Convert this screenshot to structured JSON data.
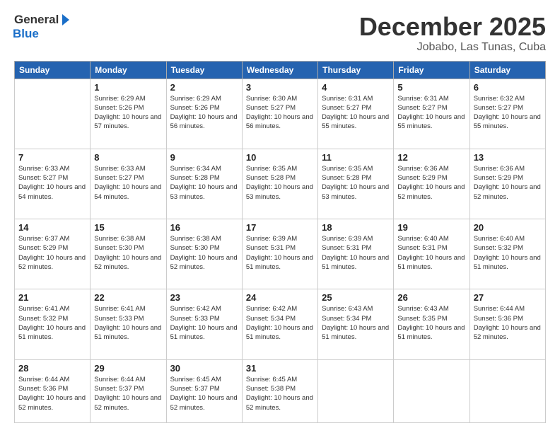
{
  "header": {
    "logo_general": "General",
    "logo_blue": "Blue",
    "month": "December 2025",
    "location": "Jobabo, Las Tunas, Cuba"
  },
  "days_of_week": [
    "Sunday",
    "Monday",
    "Tuesday",
    "Wednesday",
    "Thursday",
    "Friday",
    "Saturday"
  ],
  "weeks": [
    [
      {
        "day": "",
        "info": ""
      },
      {
        "day": "1",
        "info": "Sunrise: 6:29 AM\nSunset: 5:26 PM\nDaylight: 10 hours\nand 57 minutes."
      },
      {
        "day": "2",
        "info": "Sunrise: 6:29 AM\nSunset: 5:26 PM\nDaylight: 10 hours\nand 56 minutes."
      },
      {
        "day": "3",
        "info": "Sunrise: 6:30 AM\nSunset: 5:27 PM\nDaylight: 10 hours\nand 56 minutes."
      },
      {
        "day": "4",
        "info": "Sunrise: 6:31 AM\nSunset: 5:27 PM\nDaylight: 10 hours\nand 55 minutes."
      },
      {
        "day": "5",
        "info": "Sunrise: 6:31 AM\nSunset: 5:27 PM\nDaylight: 10 hours\nand 55 minutes."
      },
      {
        "day": "6",
        "info": "Sunrise: 6:32 AM\nSunset: 5:27 PM\nDaylight: 10 hours\nand 55 minutes."
      }
    ],
    [
      {
        "day": "7",
        "info": "Sunrise: 6:33 AM\nSunset: 5:27 PM\nDaylight: 10 hours\nand 54 minutes."
      },
      {
        "day": "8",
        "info": "Sunrise: 6:33 AM\nSunset: 5:27 PM\nDaylight: 10 hours\nand 54 minutes."
      },
      {
        "day": "9",
        "info": "Sunrise: 6:34 AM\nSunset: 5:28 PM\nDaylight: 10 hours\nand 53 minutes."
      },
      {
        "day": "10",
        "info": "Sunrise: 6:35 AM\nSunset: 5:28 PM\nDaylight: 10 hours\nand 53 minutes."
      },
      {
        "day": "11",
        "info": "Sunrise: 6:35 AM\nSunset: 5:28 PM\nDaylight: 10 hours\nand 53 minutes."
      },
      {
        "day": "12",
        "info": "Sunrise: 6:36 AM\nSunset: 5:29 PM\nDaylight: 10 hours\nand 52 minutes."
      },
      {
        "day": "13",
        "info": "Sunrise: 6:36 AM\nSunset: 5:29 PM\nDaylight: 10 hours\nand 52 minutes."
      }
    ],
    [
      {
        "day": "14",
        "info": "Sunrise: 6:37 AM\nSunset: 5:29 PM\nDaylight: 10 hours\nand 52 minutes."
      },
      {
        "day": "15",
        "info": "Sunrise: 6:38 AM\nSunset: 5:30 PM\nDaylight: 10 hours\nand 52 minutes."
      },
      {
        "day": "16",
        "info": "Sunrise: 6:38 AM\nSunset: 5:30 PM\nDaylight: 10 hours\nand 52 minutes."
      },
      {
        "day": "17",
        "info": "Sunrise: 6:39 AM\nSunset: 5:31 PM\nDaylight: 10 hours\nand 51 minutes."
      },
      {
        "day": "18",
        "info": "Sunrise: 6:39 AM\nSunset: 5:31 PM\nDaylight: 10 hours\nand 51 minutes."
      },
      {
        "day": "19",
        "info": "Sunrise: 6:40 AM\nSunset: 5:31 PM\nDaylight: 10 hours\nand 51 minutes."
      },
      {
        "day": "20",
        "info": "Sunrise: 6:40 AM\nSunset: 5:32 PM\nDaylight: 10 hours\nand 51 minutes."
      }
    ],
    [
      {
        "day": "21",
        "info": "Sunrise: 6:41 AM\nSunset: 5:32 PM\nDaylight: 10 hours\nand 51 minutes."
      },
      {
        "day": "22",
        "info": "Sunrise: 6:41 AM\nSunset: 5:33 PM\nDaylight: 10 hours\nand 51 minutes."
      },
      {
        "day": "23",
        "info": "Sunrise: 6:42 AM\nSunset: 5:33 PM\nDaylight: 10 hours\nand 51 minutes."
      },
      {
        "day": "24",
        "info": "Sunrise: 6:42 AM\nSunset: 5:34 PM\nDaylight: 10 hours\nand 51 minutes."
      },
      {
        "day": "25",
        "info": "Sunrise: 6:43 AM\nSunset: 5:34 PM\nDaylight: 10 hours\nand 51 minutes."
      },
      {
        "day": "26",
        "info": "Sunrise: 6:43 AM\nSunset: 5:35 PM\nDaylight: 10 hours\nand 51 minutes."
      },
      {
        "day": "27",
        "info": "Sunrise: 6:44 AM\nSunset: 5:36 PM\nDaylight: 10 hours\nand 52 minutes."
      }
    ],
    [
      {
        "day": "28",
        "info": "Sunrise: 6:44 AM\nSunset: 5:36 PM\nDaylight: 10 hours\nand 52 minutes."
      },
      {
        "day": "29",
        "info": "Sunrise: 6:44 AM\nSunset: 5:37 PM\nDaylight: 10 hours\nand 52 minutes."
      },
      {
        "day": "30",
        "info": "Sunrise: 6:45 AM\nSunset: 5:37 PM\nDaylight: 10 hours\nand 52 minutes."
      },
      {
        "day": "31",
        "info": "Sunrise: 6:45 AM\nSunset: 5:38 PM\nDaylight: 10 hours\nand 52 minutes."
      },
      {
        "day": "",
        "info": ""
      },
      {
        "day": "",
        "info": ""
      },
      {
        "day": "",
        "info": ""
      }
    ]
  ]
}
